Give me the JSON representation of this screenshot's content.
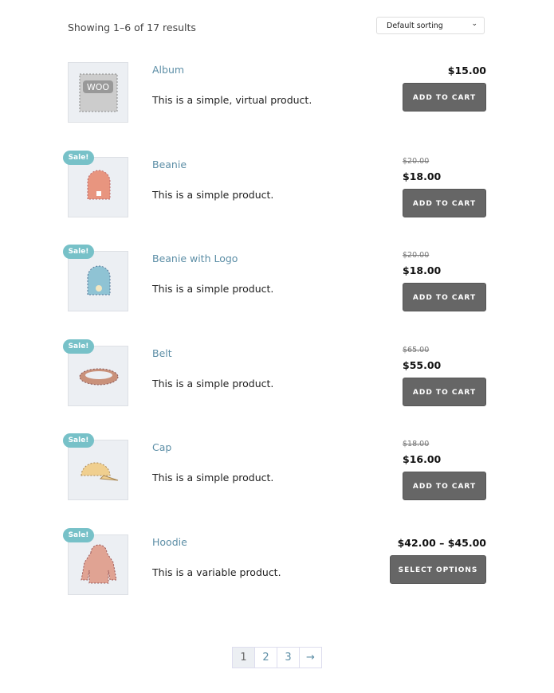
{
  "results_count": "Showing 1–6 of 17 results",
  "sorting": {
    "selected": "Default sorting",
    "icon": "chevron-down-icon"
  },
  "products": [
    {
      "name": "Album",
      "description": "This is a simple, virtual product.",
      "price": "$15.00",
      "regular_price": null,
      "sale": false,
      "button": "ADD TO CART",
      "image": "album",
      "color": "#999999"
    },
    {
      "name": "Beanie",
      "description": "This is a simple product.",
      "price": "$18.00",
      "regular_price": "$20.00",
      "sale": true,
      "button": "ADD TO CART",
      "image": "beanie",
      "color": "#e8957f"
    },
    {
      "name": "Beanie with Logo",
      "description": "This is a simple product.",
      "price": "$18.00",
      "regular_price": "$20.00",
      "sale": true,
      "button": "ADD TO CART",
      "image": "beanie-logo",
      "color": "#8fc3d4"
    },
    {
      "name": "Belt",
      "description": "This is a simple product.",
      "price": "$55.00",
      "regular_price": "$65.00",
      "sale": true,
      "button": "ADD TO CART",
      "image": "belt",
      "color": "#c9917a"
    },
    {
      "name": "Cap",
      "description": "This is a simple product.",
      "price": "$16.00",
      "regular_price": "$18.00",
      "sale": true,
      "button": "ADD TO CART",
      "image": "cap",
      "color": "#f0cf8f"
    },
    {
      "name": "Hoodie",
      "description": "This is a variable product.",
      "price": "$42.00 – $45.00",
      "regular_price": null,
      "sale": true,
      "button": "SELECT OPTIONS",
      "image": "hoodie",
      "color": "#e0a393"
    }
  ],
  "sale_badge": "Sale!",
  "pagination": {
    "pages": [
      "1",
      "2",
      "3"
    ],
    "next": "→",
    "current": "1"
  }
}
